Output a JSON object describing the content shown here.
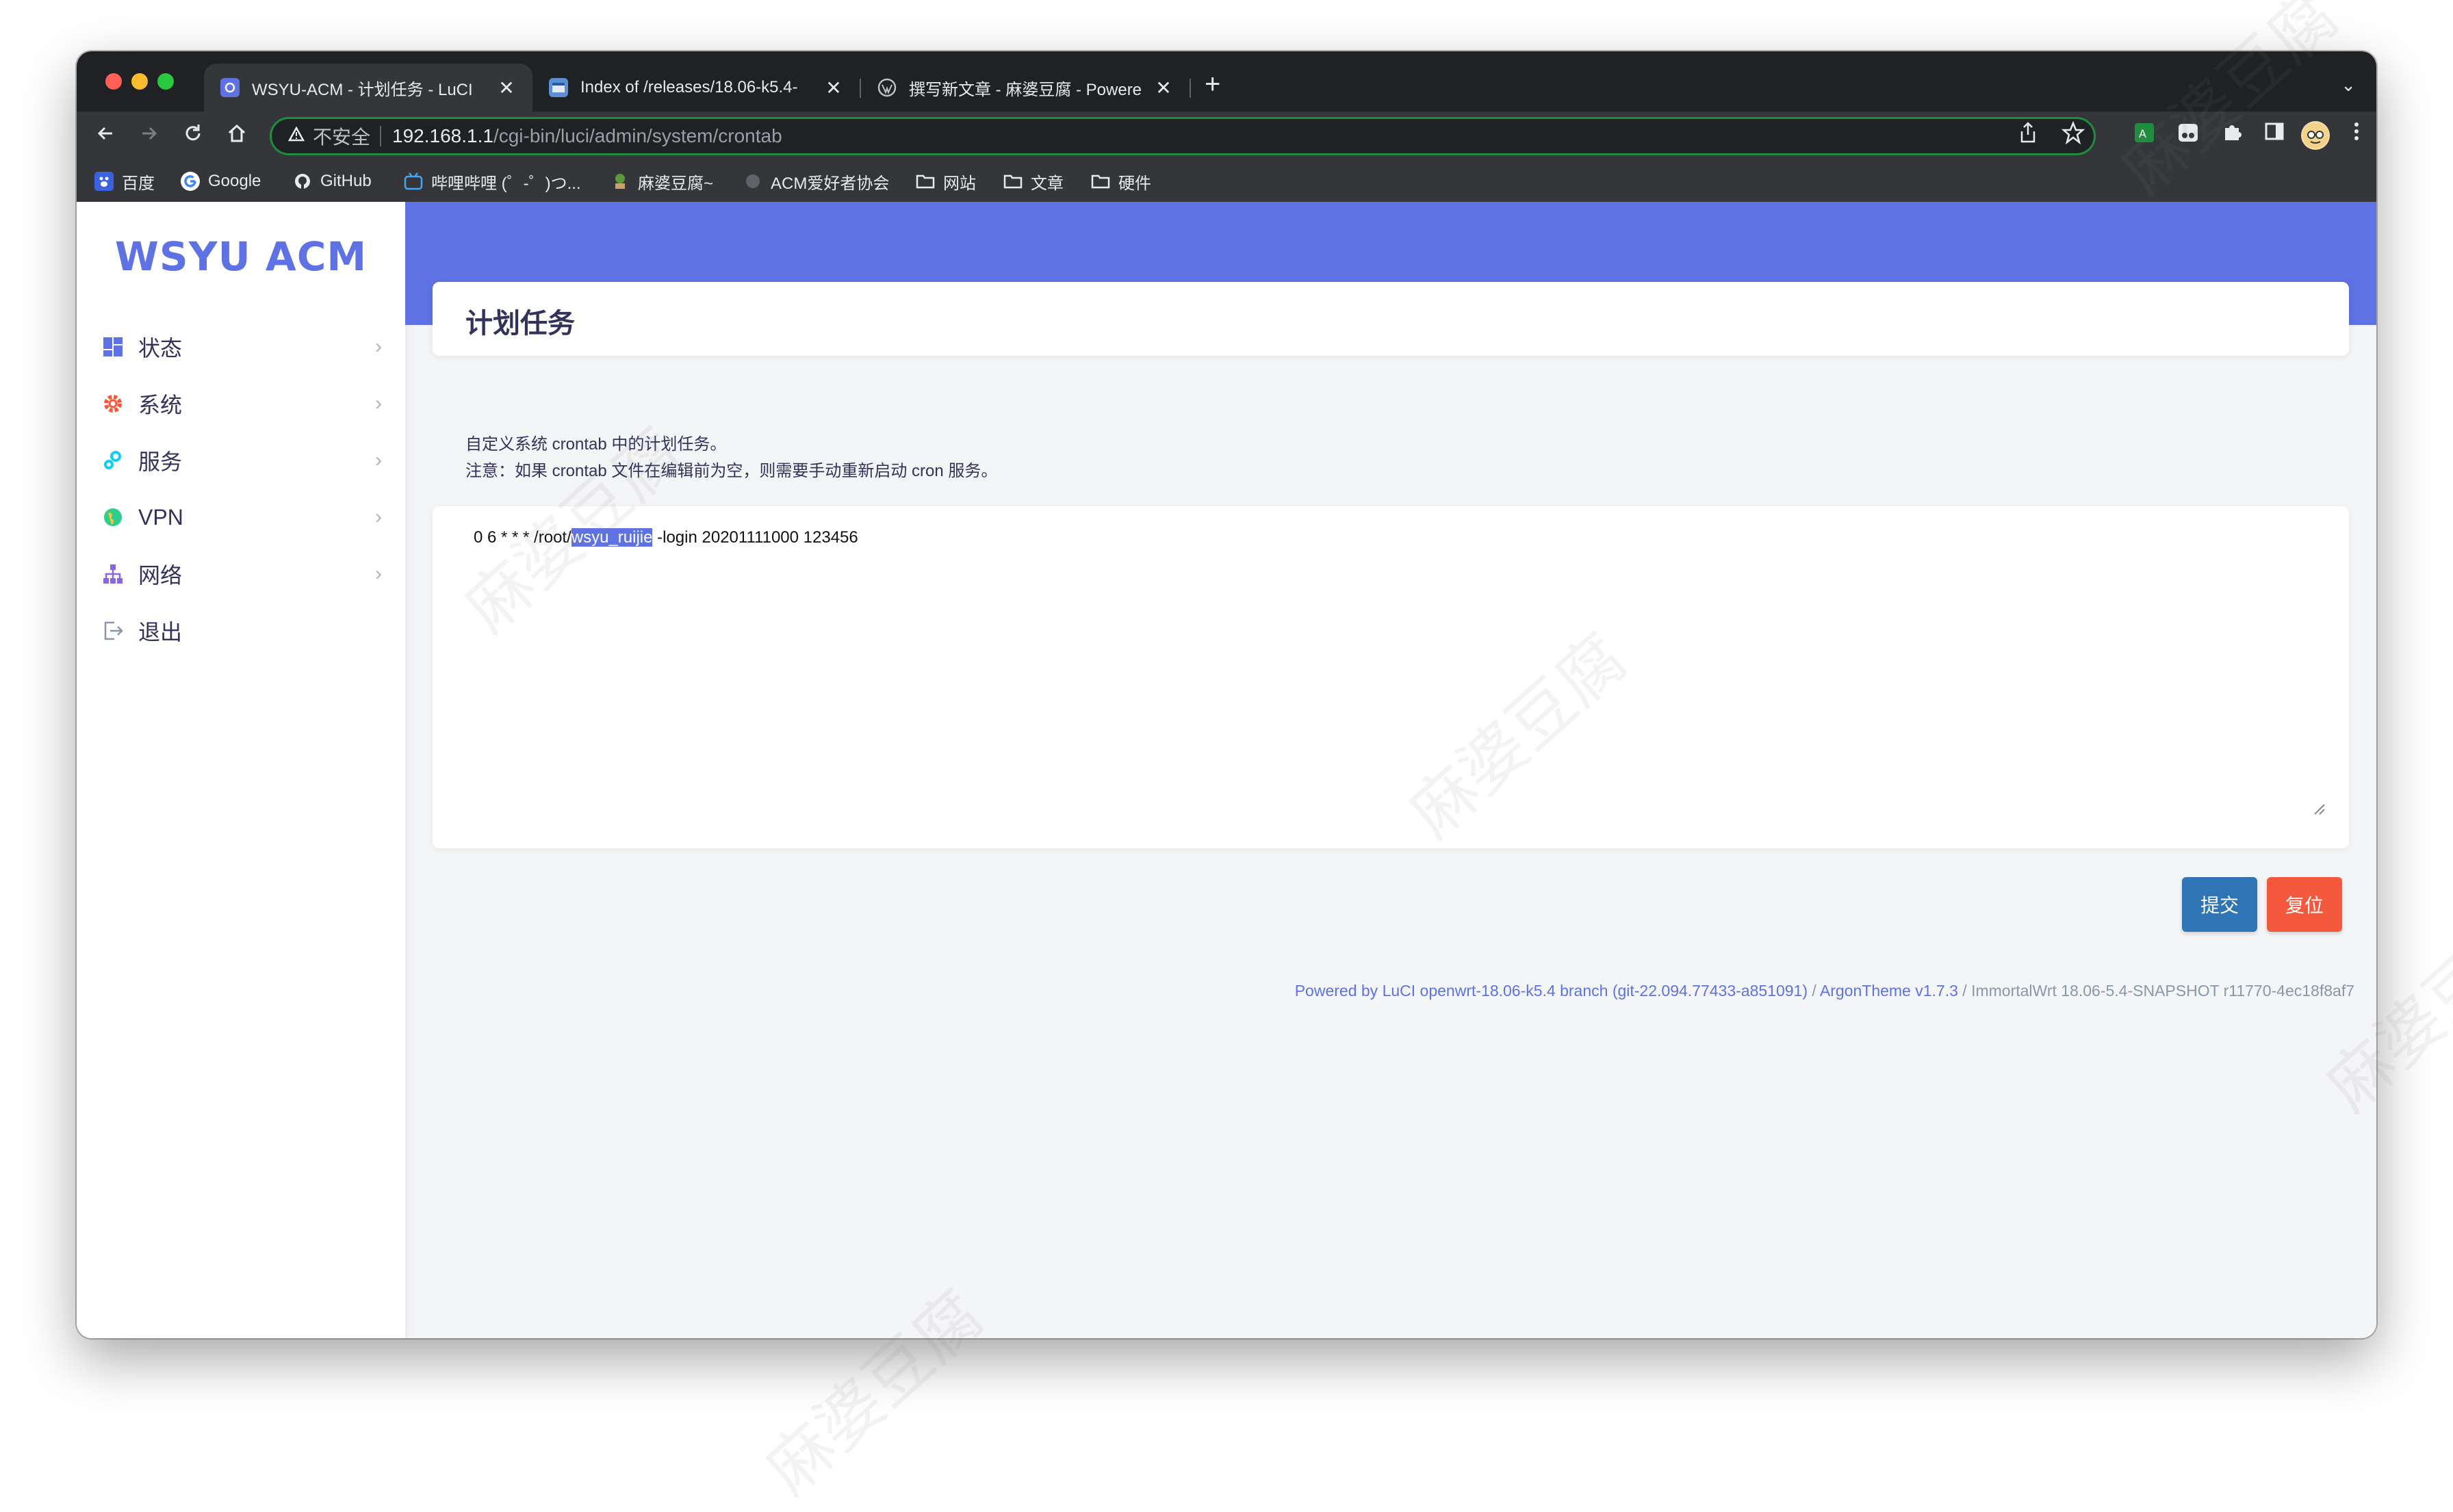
{
  "browser": {
    "tabs": [
      {
        "title": "WSYU-ACM - 计划任务 - LuCI",
        "close": "✕",
        "active": true
      },
      {
        "title": "Index of /releases/18.06-k5.4-",
        "close": "✕",
        "active": false
      },
      {
        "title": "撰写新文章 - 麻婆豆腐 - Powere",
        "close": "✕",
        "active": false
      }
    ],
    "new_tab": "+",
    "tab_menu": "⌄",
    "address": {
      "security_label": "不安全",
      "host": "192.168.1.1",
      "path": "/cgi-bin/luci/admin/system/crontab"
    },
    "bookmarks": [
      {
        "label": "百度",
        "icon": "baidu-icon"
      },
      {
        "label": "Google",
        "icon": "google-icon"
      },
      {
        "label": "GitHub",
        "icon": "github-icon"
      },
      {
        "label": "哔哩哔哩 (゜-゜)つ...",
        "icon": "bilibili-icon"
      },
      {
        "label": "麻婆豆腐~",
        "icon": "site-icon"
      },
      {
        "label": "ACM爱好者协会",
        "icon": "globe-icon"
      },
      {
        "label": "网站",
        "icon": "folder-icon"
      },
      {
        "label": "文章",
        "icon": "folder-icon"
      },
      {
        "label": "硬件",
        "icon": "folder-icon"
      }
    ]
  },
  "app": {
    "brand": "WSYU ACM",
    "menu": [
      {
        "label": "状态",
        "icon": "dashboard-icon",
        "chevron": "›"
      },
      {
        "label": "系统",
        "icon": "gear-icon",
        "chevron": "›"
      },
      {
        "label": "服务",
        "icon": "services-icon",
        "chevron": "›"
      },
      {
        "label": "VPN",
        "icon": "vpn-globe-icon",
        "chevron": "›"
      },
      {
        "label": "网络",
        "icon": "network-icon",
        "chevron": "›"
      },
      {
        "label": "退出",
        "icon": "logout-icon"
      }
    ],
    "page_title": "计划任务",
    "description": [
      "自定义系统 crontab 中的计划任务。",
      "注意：如果 crontab 文件在编辑前为空，则需要手动重新启动 cron 服务。"
    ],
    "crontab": {
      "before": "0 6 * * * /root/",
      "selected": "wsyu_ruijie",
      "after": " -login 20201111000 123456"
    },
    "buttons": {
      "submit": "提交",
      "reset": "复位"
    },
    "footer": {
      "luci": "Powered by LuCI openwrt-18.06-k5.4 branch (git-22.094.77433-a851091)",
      "sep1": " / ",
      "theme": "ArgonTheme v1.7.3",
      "sep2": " / ",
      "version": "ImmortalWrt 18.06-5.4-SNAPSHOT r11770-4ec18f8af7"
    },
    "watermark": "麻婆豆腐"
  },
  "colors": {
    "accent": "#5e72e4",
    "submit": "#2f75b5",
    "reset": "#f5593d",
    "omnibox_border": "#1e8e3e"
  }
}
